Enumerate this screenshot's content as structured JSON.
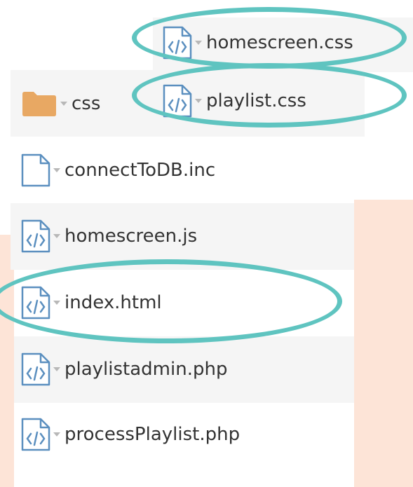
{
  "files": {
    "top_items": [
      {
        "label": "homescreen.css",
        "icon": "code-file-icon"
      },
      {
        "label": "playlist.css",
        "icon": "code-file-icon"
      }
    ],
    "folder": {
      "label": "css",
      "icon": "folder-icon"
    },
    "items": [
      {
        "label": "connectToDB.inc",
        "icon": "blank-file-icon"
      },
      {
        "label": "homescreen.js",
        "icon": "code-file-icon"
      },
      {
        "label": "index.html",
        "icon": "code-file-icon"
      },
      {
        "label": "playlistadmin.php",
        "icon": "code-file-icon"
      },
      {
        "label": "processPlaylist.php",
        "icon": "code-file-icon"
      }
    ]
  },
  "colors": {
    "highlight_ring": "#5fc4c0",
    "folder": "#e8a863",
    "icon_stroke": "#5b8fbf",
    "peach_background": "#fde4d7",
    "row_stripe": "#f5f5f5"
  }
}
